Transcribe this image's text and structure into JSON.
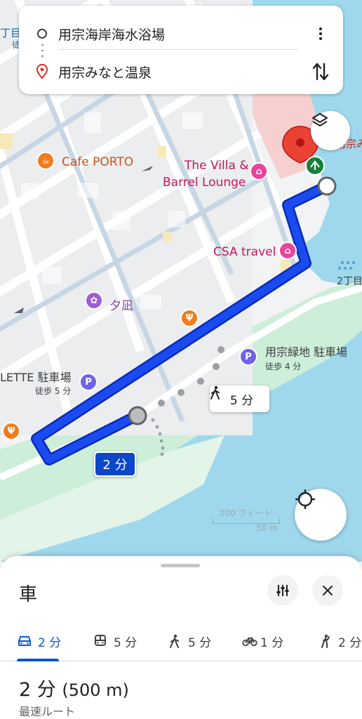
{
  "route_inputs": {
    "origin": "用宗海岸海水浴場",
    "destination": "用宗みなと温泉"
  },
  "map_labels": {
    "cafe_porto": "Cafe PORTO",
    "villa_line1": "The Villa &",
    "villa_line2": "Barrel Lounge",
    "csa_travel": "CSA travel",
    "yunagi": "夕凪",
    "parking_mochimune": "用宗緑地 駐車場",
    "parking_mochimune_walk": "徒歩 4 分",
    "parking_lette": "LETTE 駐車場",
    "parking_lette_walk": "徒歩 5 分",
    "chome_right": "2丁目",
    "chome_left": "丁目",
    "chome_left_sub": "徒",
    "minato_partial": "用宗みな"
  },
  "chips": {
    "drive_time": "2 分",
    "walk_time": "5 分"
  },
  "scale": {
    "feet": "200 フィート",
    "meters": "50 m"
  },
  "sheet": {
    "title": "車",
    "modes": [
      {
        "icon": "car-icon",
        "label": "2 分",
        "active": true
      },
      {
        "icon": "transit-icon",
        "label": "5 分",
        "active": false
      },
      {
        "icon": "walk-icon",
        "label": "5 分",
        "active": false
      },
      {
        "icon": "bike-icon",
        "label": "1 分",
        "active": false
      },
      {
        "icon": "ride-icon",
        "label": "2 分",
        "active": false
      }
    ],
    "summary_time": "2 分",
    "summary_distance": "(500 m)",
    "route_label": "最速ルート"
  },
  "colors": {
    "route": "#1a4bf0",
    "water": "#9fd8ec",
    "park": "#c9ecd4",
    "road": "#c7d6e4",
    "block": "#ececec"
  }
}
